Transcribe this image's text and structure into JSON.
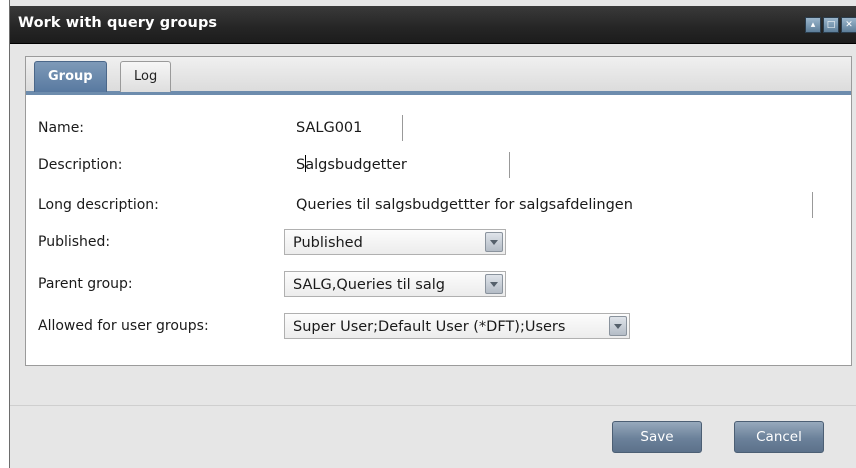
{
  "window": {
    "title": "Work with query groups"
  },
  "tabs": [
    {
      "label": "Group",
      "active": true
    },
    {
      "label": "Log",
      "active": false
    }
  ],
  "form": {
    "name": {
      "label": "Name:",
      "value": "SALG001"
    },
    "description": {
      "label": "Description:",
      "value_prefix": "S",
      "value_suffix": "algsbudgetter"
    },
    "long_description": {
      "label": "Long description:",
      "value": "Queries til salgsbudgettter for salgsafdelingen"
    },
    "published": {
      "label": "Published:",
      "value": "Published"
    },
    "parent_group": {
      "label": "Parent group:",
      "value": "SALG,Queries til salg"
    },
    "allowed_user_groups": {
      "label": "Allowed for user groups:",
      "value": "Super User;Default User (*DFT);Users"
    }
  },
  "buttons": {
    "save": "Save",
    "cancel": "Cancel"
  },
  "colors": {
    "titlebar": "#262626",
    "tab_active": "#5879a0",
    "button": "#6b819a"
  }
}
